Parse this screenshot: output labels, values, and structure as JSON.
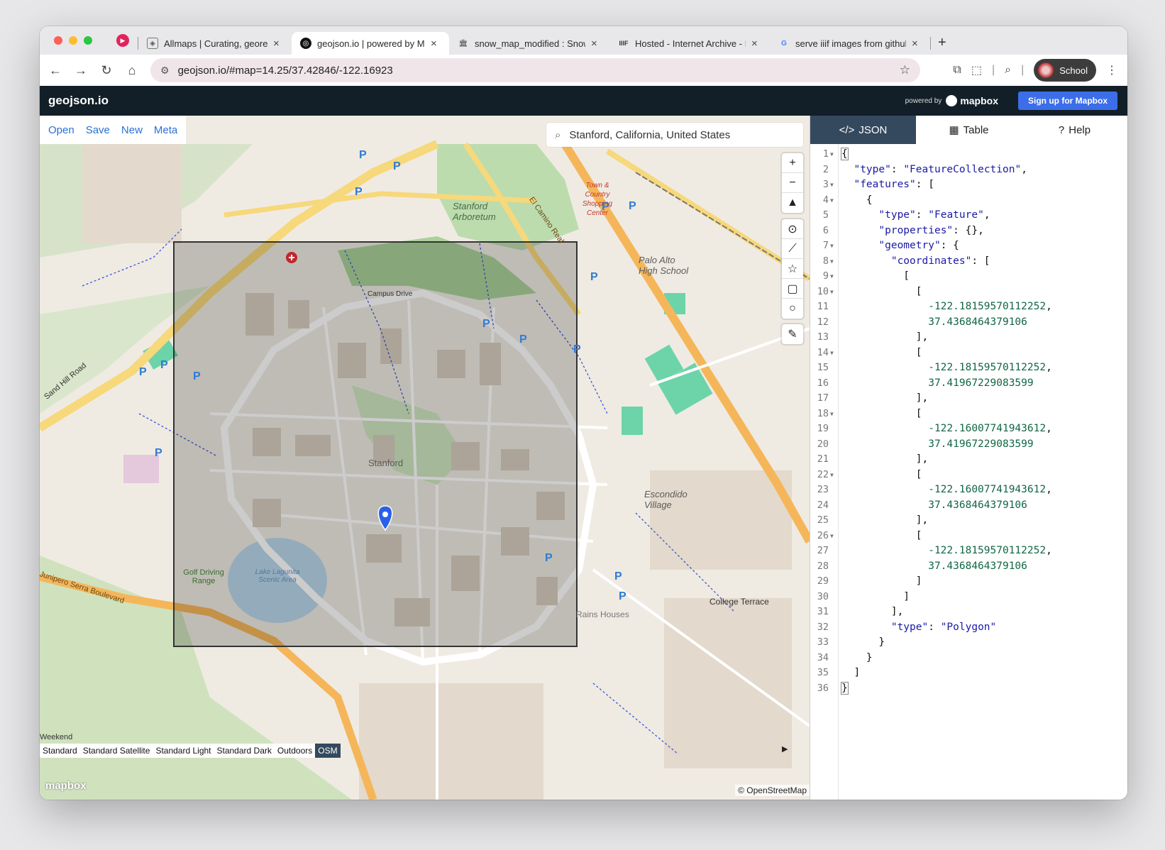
{
  "browser": {
    "tabs": [
      {
        "title": "Allmaps | Curating, georeferen",
        "favicon": "allmaps-icon",
        "active": false
      },
      {
        "title": "geojson.io | powered by Mapb",
        "favicon": "geojson-icon",
        "active": true
      },
      {
        "title": "snow_map_modified : Snow,",
        "favicon": "archive-icon",
        "active": false
      },
      {
        "title": "Hosted - Internet Archive - IIIF",
        "favicon": "iiif-icon",
        "active": false
      },
      {
        "title": "serve iiif images from github",
        "favicon": "google-icon",
        "active": false
      }
    ],
    "url": "geojson.io/#map=14.25/37.42846/-122.16923",
    "profile_name": "School"
  },
  "app": {
    "logo": "geojson.io",
    "powered_by": "powered by",
    "mapbox_brand": "mapbox",
    "signup_label": "Sign up for Mapbox"
  },
  "menu": [
    "Open",
    "Save",
    "New",
    "Meta"
  ],
  "search": {
    "value": "Stanford, California, United States"
  },
  "map_controls": [
    "zoom-in",
    "zoom-out",
    "compass",
    "draw-point",
    "draw-line",
    "draw-polygon",
    "draw-rectangle",
    "draw-circle",
    "edit"
  ],
  "map_labels": {
    "stanford": "Stanford",
    "campus_drive": "Campus Drive",
    "arboretum": "Stanford Arboretum",
    "palo_alto_hs": "Palo Alto High School",
    "escondido": "Escondido Village",
    "golf": "Golf Driving Range",
    "lagunita": "Lake Lagunita Scenic Area",
    "junipero": "Junipero Serra Boulevard",
    "el_camino": "El Camino Real",
    "sand_hill": "Sand Hill Road",
    "college_terrace": "College Terrace",
    "rains_houses": "Rains Houses",
    "town_country": "Town & Country Shopping Center",
    "weekend": "Weekend"
  },
  "style_options": [
    "Standard",
    "Standard Satellite",
    "Standard Light",
    "Standard Dark",
    "Outdoors",
    "OSM"
  ],
  "selected_style": "OSM",
  "attribution": "© OpenStreetMap",
  "mapbox_logo": "mapbox",
  "panel_tabs": [
    {
      "label": "JSON",
      "icon": "code-icon",
      "active": true
    },
    {
      "label": "Table",
      "icon": "table-icon",
      "active": false
    },
    {
      "label": "Help",
      "icon": "help-icon",
      "active": false
    }
  ],
  "json_lines": [
    "{",
    "  \"type\": \"FeatureCollection\",",
    "  \"features\": [",
    "    {",
    "      \"type\": \"Feature\",",
    "      \"properties\": {},",
    "      \"geometry\": {",
    "        \"coordinates\": [",
    "          [",
    "            [",
    "              -122.18159570112252,",
    "              37.4368464379106",
    "            ],",
    "            [",
    "              -122.18159570112252,",
    "              37.41967229083599",
    "            ],",
    "            [",
    "              -122.16007741943612,",
    "              37.41967229083599",
    "            ],",
    "            [",
    "              -122.16007741943612,",
    "              37.4368464379106",
    "            ],",
    "            [",
    "              -122.18159570112252,",
    "              37.4368464379106",
    "            ]",
    "          ]",
    "        ],",
    "        \"type\": \"Polygon\"",
    "      }",
    "    }",
    "  ]",
    "}"
  ],
  "fold_lines": [
    1,
    3,
    4,
    7,
    8,
    9,
    10,
    14,
    18,
    22,
    26
  ],
  "colors": {
    "header_bg": "#121f28",
    "accent_blue": "#3b6ee8",
    "active_tab": "#34495e",
    "json_key": "#1a1aa6",
    "json_number": "#116644"
  }
}
